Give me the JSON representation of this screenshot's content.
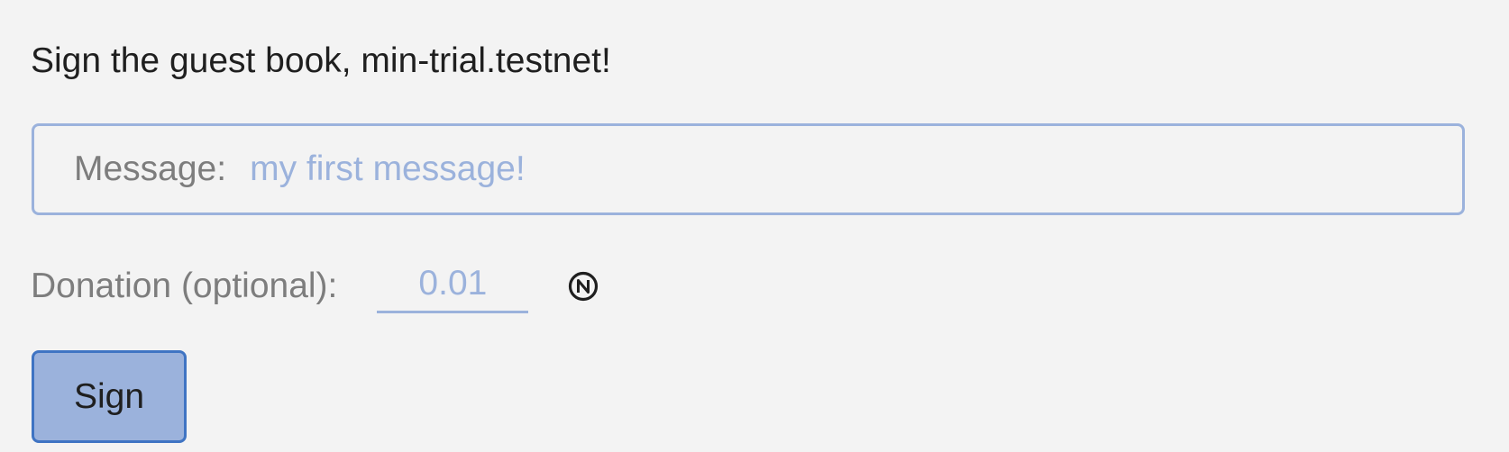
{
  "form": {
    "heading": "Sign the guest book, min-trial.testnet!",
    "message": {
      "label": "Message:",
      "placeholder": "my first message!",
      "value": ""
    },
    "donation": {
      "label": "Donation (optional):",
      "placeholder": "0.01",
      "value": "",
      "currency_icon": "near-token-icon"
    },
    "submit_label": "Sign"
  },
  "colors": {
    "background": "#f3f3f3",
    "accent": "#9bb2dc",
    "button_border": "#3f74c3",
    "label_text": "#7d7d7d",
    "heading_text": "#1f1f1f"
  }
}
